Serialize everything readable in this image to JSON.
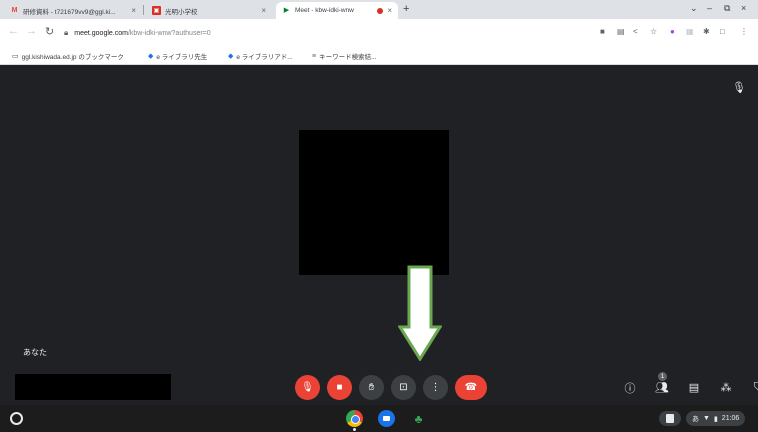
{
  "browser": {
    "tabs": [
      {
        "favicon": "gmail-icon",
        "title": "研修資料 - t721679vv9@ggl.ki...",
        "close": "×"
      },
      {
        "favicon": "school-icon",
        "title": "光明小学校",
        "close": "×"
      },
      {
        "favicon": "meet-icon",
        "title": "Meet - kbw-idki-wnw",
        "close": "×",
        "recording": true
      }
    ],
    "new_tab": "+",
    "window_controls": {
      "menu": "⌄",
      "minimize": "–",
      "restore": "⧉",
      "close": "×"
    },
    "address_bar": {
      "host": "meet.google.com",
      "path": "/kbw-idki-wnw?authuser=0"
    },
    "bookmarks": [
      {
        "icon": "folder-icon",
        "label": "ggl.kishiwada.ed.jp のブックマーク"
      },
      {
        "icon": "bookmark-icon",
        "label": "e ライブラリ先生"
      },
      {
        "icon": "bookmark-icon",
        "label": "e ライブラリアド..."
      },
      {
        "icon": "keyword-icon",
        "label": "キーワード検索結..."
      }
    ]
  },
  "meet": {
    "self_label": "あなた",
    "participants_count": "1",
    "colors": {
      "stage": "#202124",
      "danger": "#ea4335",
      "arrow": "#6aa84f"
    }
  },
  "shelf": {
    "ime": "あ",
    "time": "21:06"
  }
}
